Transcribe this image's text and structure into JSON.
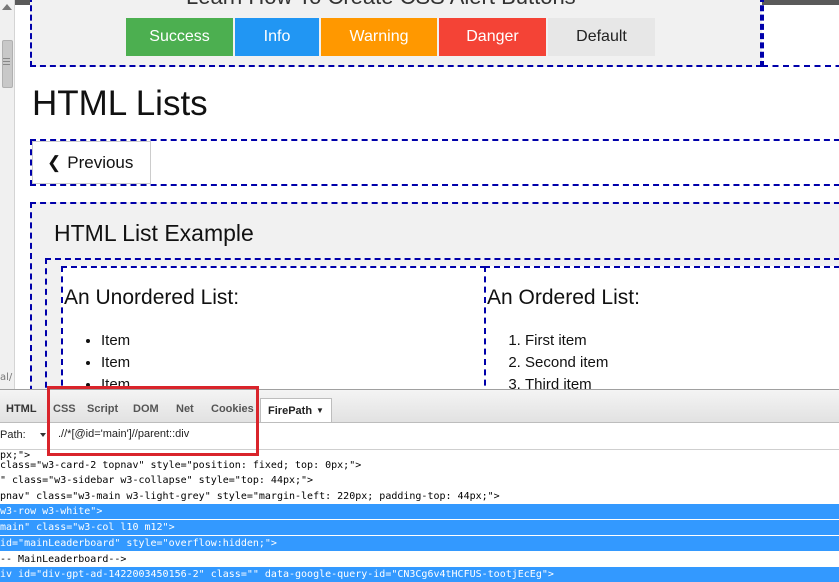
{
  "top_heading_partial": "Learn How To Create CSS Alert Buttons",
  "buttons": {
    "success": "Success",
    "info": "Info",
    "warning": "Warning",
    "danger": "Danger",
    "default": "Default"
  },
  "page_title": "HTML Lists",
  "previous_label": "Previous",
  "example_title": "HTML List Example",
  "unordered": {
    "title": "An Unordered List:",
    "items": [
      "Item",
      "Item",
      "Item"
    ]
  },
  "ordered": {
    "title": "An Ordered List:",
    "items": [
      "First item",
      "Second item",
      "Third item"
    ]
  },
  "url_fragment": "al/",
  "devtools": {
    "tabs": [
      "HTML",
      "CSS",
      "Script",
      "DOM",
      "Net",
      "Cookies",
      "FirePath"
    ],
    "xpath_label": "Path:",
    "xpath_value": ".//*[@id='main']//parent::div"
  },
  "code_lines": [
    {
      "text": "px;\">",
      "selected": false
    },
    {
      "text": "  class=\"w3-card-2 topnav\" style=\"position: fixed; top: 0px;\">",
      "selected": false
    },
    {
      "text": "\" class=\"w3-sidebar w3-collapse\" style=\"top: 44px;\">",
      "selected": false
    },
    {
      "text": "pnav\" class=\"w3-main w3-light-grey\" style=\"margin-left: 220px; padding-top: 44px;\">",
      "selected": false
    },
    {
      "text": "w3-row w3-white\">",
      "selected": true
    },
    {
      "text": "main\" class=\"w3-col l10 m12\">",
      "selected": true
    },
    {
      "text": "id=\"mainLeaderboard\" style=\"overflow:hidden;\">",
      "selected": true
    },
    {
      "text": "-- MainLeaderboard-->",
      "selected": false
    },
    {
      "text": "iv id=\"div-gpt-ad-1422003450156-2\" class=\"\" data-google-query-id=\"CN3Cg6v4tHCFUS-tootjEcEg\">",
      "selected": true
    }
  ],
  "colors": {
    "success": "#4caf50",
    "info": "#2196f3",
    "warning": "#ff9800",
    "danger": "#f44336",
    "default": "#e7e7e7",
    "selection": "#3399ff",
    "highlight_box": "#d9242b",
    "dashed_outline": "#0000aa"
  }
}
